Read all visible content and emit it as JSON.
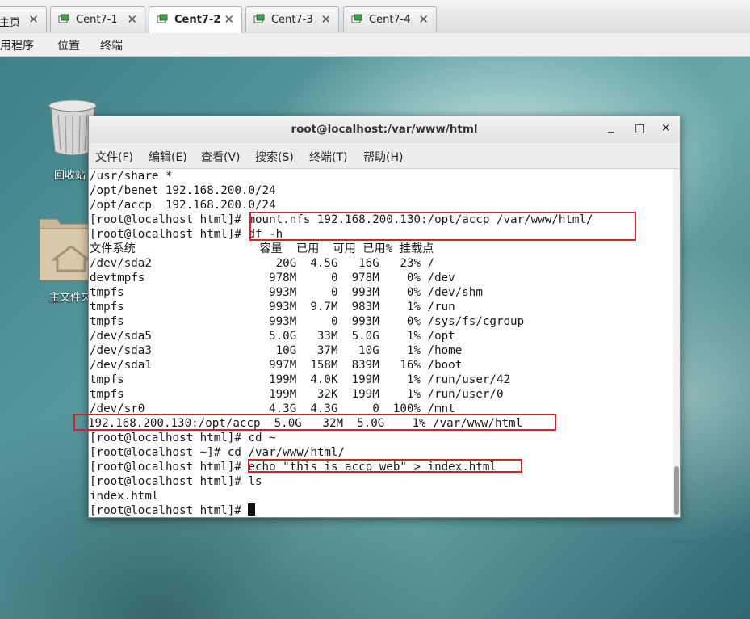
{
  "host_tabs": [
    {
      "label": "主页"
    },
    {
      "label": "Cent7-1"
    },
    {
      "label": "Cent7-2"
    },
    {
      "label": "Cent7-3"
    },
    {
      "label": "Cent7-4"
    }
  ],
  "guest_menu": {
    "apps": "应用程序",
    "places": "位置",
    "terminal": "终端"
  },
  "desktop": {
    "trash_label": "回收站",
    "home_label": "主文件夹"
  },
  "window": {
    "title": "root@localhost:/var/www/html",
    "minimize": "_",
    "maximize": "□",
    "close": "✕"
  },
  "term_menu": [
    "文件(F)",
    "编辑(E)",
    "查看(V)",
    "搜索(S)",
    "终端(T)",
    "帮助(H)"
  ],
  "console_lines": [
    "/usr/share *",
    "/opt/benet 192.168.200.0/24",
    "/opt/accp  192.168.200.0/24",
    "[root@localhost html]# mount.nfs 192.168.200.130:/opt/accp /var/www/html/",
    "[root@localhost html]# df -h",
    "文件系统                  容量  已用  可用 已用% 挂载点",
    "/dev/sda2                  20G  4.5G   16G   23% /",
    "devtmpfs                  978M     0  978M    0% /dev",
    "tmpfs                     993M     0  993M    0% /dev/shm",
    "tmpfs                     993M  9.7M  983M    1% /run",
    "tmpfs                     993M     0  993M    0% /sys/fs/cgroup",
    "/dev/sda5                 5.0G   33M  5.0G    1% /opt",
    "/dev/sda3                  10G   37M   10G    1% /home",
    "/dev/sda1                 997M  158M  839M   16% /boot",
    "tmpfs                     199M  4.0K  199M    1% /run/user/42",
    "tmpfs                     199M   32K  199M    1% /run/user/0",
    "/dev/sr0                  4.3G  4.3G     0  100% /mnt",
    "192.168.200.130:/opt/accp  5.0G   32M  5.0G    1% /var/www/html",
    "[root@localhost html]# cd ~",
    "[root@localhost ~]# cd /var/www/html/",
    "[root@localhost html]# echo \"this is accp web\" > index.html",
    "[root@localhost html]# ls",
    "index.html",
    "[root@localhost html]# "
  ],
  "colors": {
    "highlight": "#d0242a",
    "tab_icon": "#3fa14a"
  }
}
